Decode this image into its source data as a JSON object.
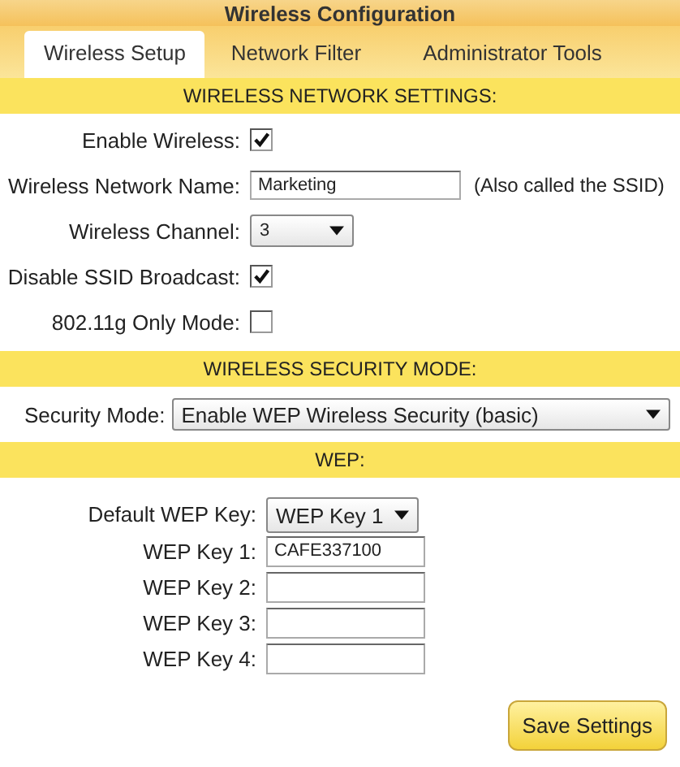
{
  "window": {
    "title": "Wireless Configuration"
  },
  "tabs": [
    {
      "label": "Wireless Setup",
      "selected": true
    },
    {
      "label": "Network Filter",
      "selected": false
    },
    {
      "label": "Administrator Tools",
      "selected": false
    }
  ],
  "network_settings": {
    "heading": "WIRELESS NETWORK SETTINGS:",
    "fields": [
      {
        "kind": "checkbox",
        "label": "Enable Wireless:",
        "checked": true
      },
      {
        "kind": "text",
        "label": "Wireless Network Name:",
        "value": "Marketing",
        "note": "(Also called the SSID)"
      },
      {
        "kind": "select",
        "label": "Wireless Channel:",
        "value": "3"
      },
      {
        "kind": "checkbox",
        "label": "Disable SSID Broadcast:",
        "checked": true
      },
      {
        "kind": "checkbox",
        "label": "802.11g Only Mode:",
        "checked": false
      }
    ]
  },
  "security": {
    "heading": "WIRELESS SECURITY MODE:",
    "label": "Security Mode:",
    "value": "Enable WEP Wireless Security (basic)"
  },
  "wep": {
    "heading": "WEP:",
    "default_key": {
      "label": "Default WEP Key:",
      "value": "WEP Key 1"
    },
    "keys": [
      {
        "label": "WEP Key 1:",
        "value": "CAFE337100"
      },
      {
        "label": "WEP Key 2:"
      },
      {
        "label": "WEP Key 3:"
      },
      {
        "label": "WEP Key 4:"
      }
    ]
  },
  "save_button": "Save Settings"
}
